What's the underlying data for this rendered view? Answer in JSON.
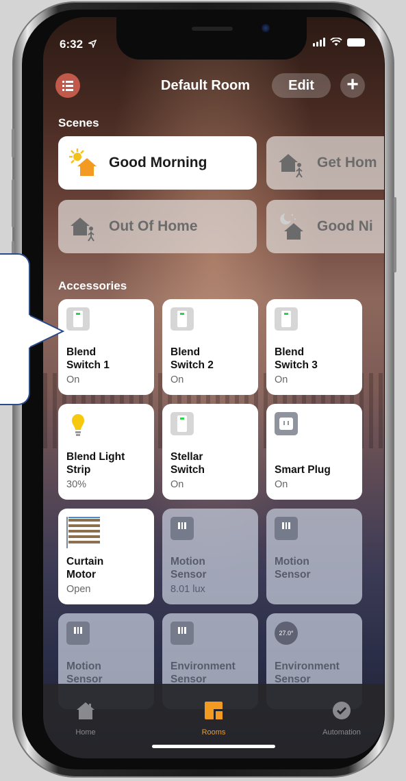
{
  "status_bar": {
    "time": "6:32"
  },
  "nav": {
    "title": "Default Room",
    "edit_label": "Edit",
    "add_label": "+"
  },
  "scenes": {
    "section_label": "Scenes",
    "items": [
      {
        "label": "Good Morning",
        "icon": "sun-house-icon",
        "active": true
      },
      {
        "label": "Get Hom",
        "icon": "person-home-icon",
        "active": false
      },
      {
        "label": "Out Of Home",
        "icon": "person-away-icon",
        "active": false
      },
      {
        "label": "Good Ni",
        "icon": "moon-house-icon",
        "active": false
      }
    ]
  },
  "accessories": {
    "section_label": "Accessories",
    "items": [
      {
        "name": "Blend\nSwitch 1",
        "status": "On",
        "icon": "switch-icon",
        "on": true
      },
      {
        "name": "Blend\nSwitch 2",
        "status": "On",
        "icon": "switch-icon",
        "on": true
      },
      {
        "name": "Blend\nSwitch 3",
        "status": "On",
        "icon": "switch-icon",
        "on": true
      },
      {
        "name": "Blend Light\nStrip",
        "status": "30%",
        "icon": "lightbulb-icon",
        "on": true
      },
      {
        "name": "Stellar\nSwitch",
        "status": "On",
        "icon": "switch-icon",
        "on": true
      },
      {
        "name": "Smart Plug",
        "status": "On",
        "icon": "plug-icon",
        "on": true
      },
      {
        "name": "Curtain\nMotor",
        "status": "Open",
        "icon": "curtain-icon",
        "on": true
      },
      {
        "name": "Motion\nSensor",
        "status": "8.01 lux",
        "icon": "sensor-icon",
        "on": false
      },
      {
        "name": "Motion\nSensor",
        "status": "",
        "icon": "sensor-icon",
        "on": false
      },
      {
        "name": "Motion\nSensor",
        "status": "",
        "icon": "sensor-icon",
        "on": false
      },
      {
        "name": "Environment\nSensor",
        "status": "",
        "icon": "sensor-icon",
        "on": false
      },
      {
        "name": "Environment\nSensor",
        "status": "",
        "icon": "thermometer-icon",
        "temperature": "27.0°",
        "on": false
      }
    ]
  },
  "tabbar": {
    "tabs": [
      {
        "label": "Home",
        "icon": "house-icon",
        "selected": false
      },
      {
        "label": "Rooms",
        "icon": "rooms-icon",
        "selected": true
      },
      {
        "label": "Automation",
        "icon": "automation-icon",
        "selected": false
      }
    ]
  },
  "colors": {
    "accent": "#f29a21",
    "menu_button": "#c25a4b",
    "switch_led": "#2bd34f",
    "callout_border": "#2b4a8a"
  }
}
